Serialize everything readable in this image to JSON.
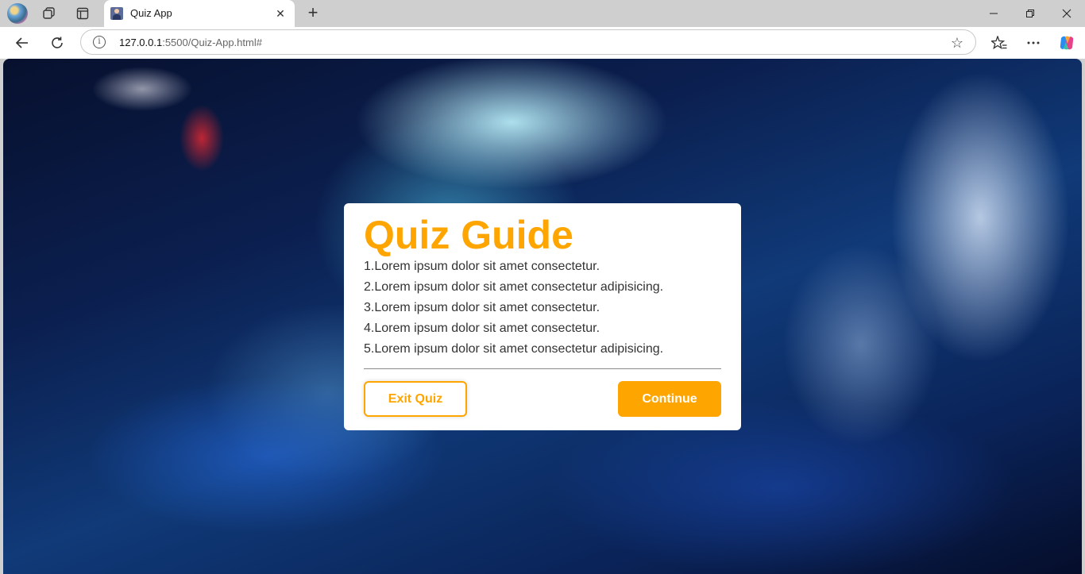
{
  "browser": {
    "tab_title": "Quiz App",
    "url_host": "127.0.0.1",
    "url_rest": ":5500/Quiz-App.html#"
  },
  "quiz": {
    "title": "Quiz Guide",
    "rules": [
      "1.Lorem ipsum dolor sit amet consectetur.",
      "2.Lorem ipsum dolor sit amet consectetur adipisicing.",
      "3.Lorem ipsum dolor sit amet consectetur.",
      "4.Lorem ipsum dolor sit amet consectetur.",
      "5.Lorem ipsum dolor sit amet consectetur adipisicing."
    ],
    "exit_label": "Exit Quiz",
    "continue_label": "Continue"
  },
  "icons": {
    "profile": "profile-avatar-icon",
    "workspaces": "workspaces-icon",
    "tab_actions": "tab-actions-icon",
    "back": "back-arrow-icon",
    "refresh": "refresh-icon",
    "info": "info-icon",
    "favorite": "star-icon",
    "favorites": "favorites-icon",
    "more": "more-icon",
    "copilot": "copilot-icon"
  },
  "colors": {
    "accent": "#ffa500",
    "card_bg": "#ffffff",
    "text": "#333333"
  }
}
